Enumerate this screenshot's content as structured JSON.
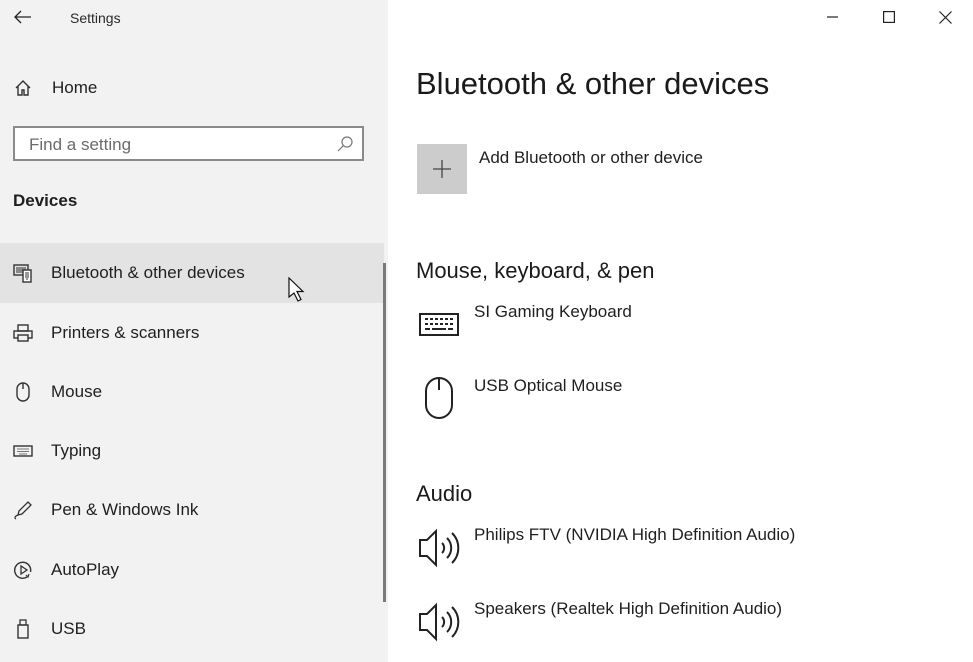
{
  "window": {
    "title": "Settings",
    "controls": {
      "minimize_icon": "minimize-icon",
      "maximize_icon": "maximize-icon",
      "close_icon": "close-icon"
    }
  },
  "sidebar": {
    "back_icon": "back-arrow-icon",
    "home": {
      "label": "Home",
      "icon": "home-icon"
    },
    "search": {
      "placeholder": "Find a setting",
      "value": "",
      "icon": "search-icon"
    },
    "section_title": "Devices",
    "items": [
      {
        "label": "Bluetooth & other devices",
        "icon": "bluetooth-devices-icon",
        "selected": true
      },
      {
        "label": "Printers & scanners",
        "icon": "printer-icon",
        "selected": false
      },
      {
        "label": "Mouse",
        "icon": "mouse-icon",
        "selected": false
      },
      {
        "label": "Typing",
        "icon": "keyboard-icon",
        "selected": false
      },
      {
        "label": "Pen & Windows Ink",
        "icon": "pen-icon",
        "selected": false
      },
      {
        "label": "AutoPlay",
        "icon": "autoplay-icon",
        "selected": false
      },
      {
        "label": "USB",
        "icon": "usb-icon",
        "selected": false
      }
    ]
  },
  "main": {
    "page_title": "Bluetooth & other devices",
    "add_device": {
      "label": "Add Bluetooth or other device",
      "icon": "plus-icon"
    },
    "groups": [
      {
        "title": "Mouse, keyboard, & pen",
        "devices": [
          {
            "name": "SI Gaming Keyboard",
            "icon": "keyboard-icon"
          },
          {
            "name": "USB Optical Mouse",
            "icon": "mouse-icon"
          }
        ]
      },
      {
        "title": "Audio",
        "devices": [
          {
            "name": "Philips FTV (NVIDIA High Definition Audio)",
            "icon": "speaker-icon"
          },
          {
            "name": "Speakers (Realtek High Definition Audio)",
            "icon": "speaker-icon"
          }
        ]
      }
    ]
  },
  "colors": {
    "sidebar_bg": "#f2f2f2",
    "selected_bg": "#e3e3e3",
    "add_tile_bg": "#cccccc",
    "text": "#1f1f1f"
  }
}
